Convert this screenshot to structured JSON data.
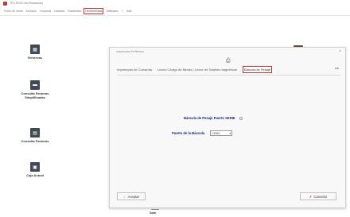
{
  "window": {
    "title": "TPV-ESSO Bar Restaurant"
  },
  "menubar": {
    "items": [
      {
        "label": "Punto de venta"
      },
      {
        "label": "Archivos"
      },
      {
        "label": "Compras"
      },
      {
        "label": "Listados"
      },
      {
        "label": "Estadística"
      },
      {
        "label": "Herramientas",
        "highlight": true
      },
      {
        "label": "Utilidades"
      },
      {
        "label": "?"
      },
      {
        "label": "Salir"
      }
    ]
  },
  "desktop_icons": [
    {
      "label": "Reservas"
    },
    {
      "label": "Consulta Facturas Simplificadas"
    },
    {
      "label": "Consulta Facturas"
    },
    {
      "label": "Caja Actual"
    }
  ],
  "bottom_label": "Salir",
  "dialog": {
    "title": "Impresoras Periféricos",
    "tabs": [
      {
        "label": "Impresoras de Comanda"
      },
      {
        "label": "Lector Código de Barras | Lector de Tarjetas magnéticas"
      },
      {
        "label": "Báscula de Pesaje",
        "active": true
      }
    ],
    "form": {
      "scale_label": "Báscula de Pesaje Puerto SERIE",
      "port_label": "Puerto de la Báscula",
      "port_value": "COM1"
    },
    "buttons": {
      "accept": "Aceptar",
      "cancel": "Cancelar"
    }
  }
}
